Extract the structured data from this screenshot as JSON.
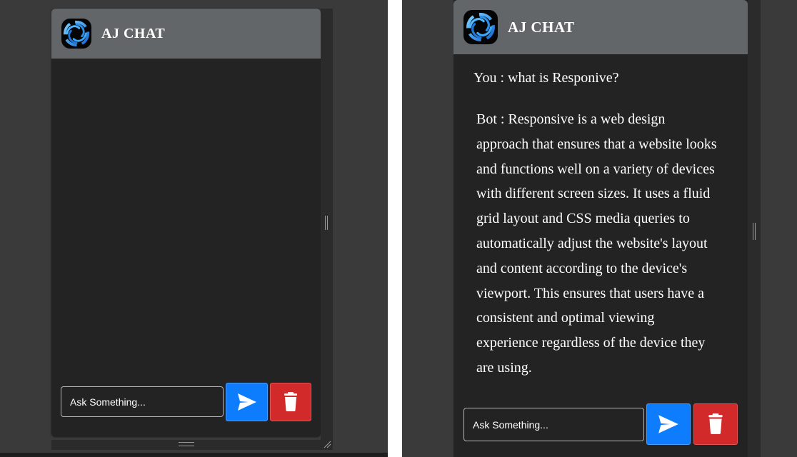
{
  "app": {
    "title": "AJ CHAT"
  },
  "input": {
    "placeholder": "Ask Something..."
  },
  "conversation": {
    "user_message": "You : what is Responive?",
    "bot_message": "Bot : Responsive is a web design approach that ensures that a website looks and functions well on a variety of devices with different screen sizes. It uses a fluid grid layout and CSS media queries to automatically adjust the website's layout and content according to the device's viewport. This ensures that users have a consistent and optimal viewing experience regardless of the device they are using."
  },
  "icons": {
    "logo": "swirl-logo-icon",
    "send": "send-icon",
    "delete": "trash-icon",
    "resize": "resize-grip-icon"
  },
  "colors": {
    "header": "#636668",
    "chat_background": "#232323",
    "send_button": "#0d7dfd",
    "delete_button": "#d22a2a",
    "page_background": "#3a3a3a"
  }
}
